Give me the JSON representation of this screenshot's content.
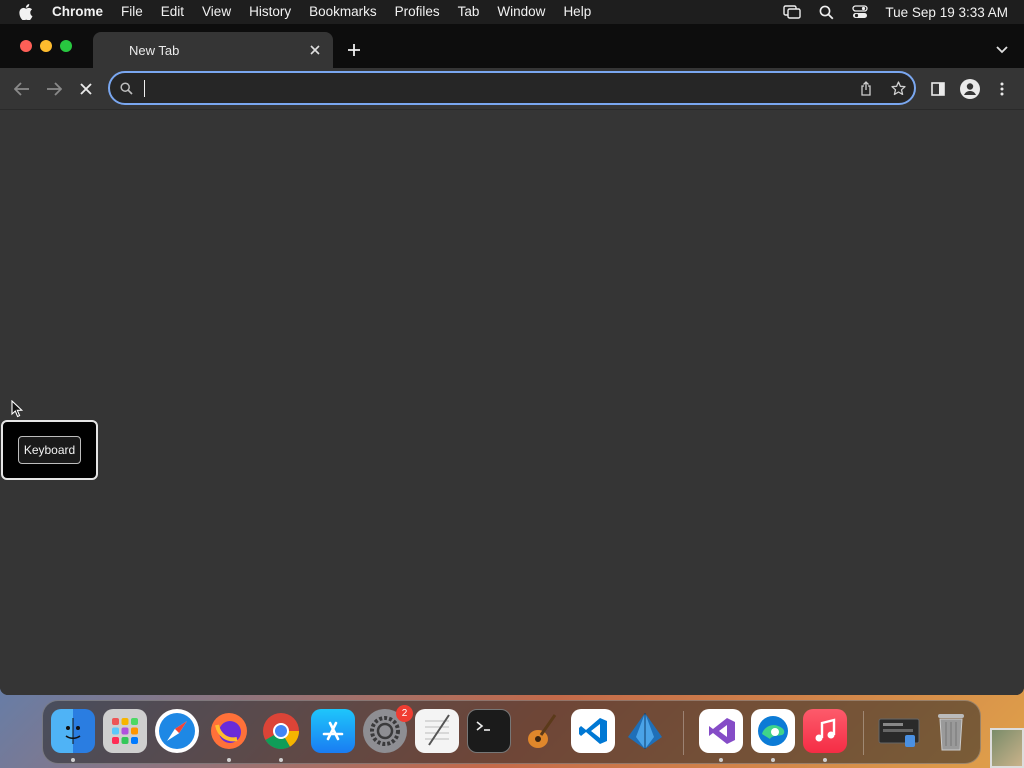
{
  "menubar": {
    "app_name": "Chrome",
    "items": [
      "File",
      "Edit",
      "View",
      "History",
      "Bookmarks",
      "Profiles",
      "Tab",
      "Window",
      "Help"
    ],
    "clock": "Tue Sep 19  3:33 AM"
  },
  "tabs": [
    {
      "title": "New Tab",
      "active": true
    }
  ],
  "omnibox": {
    "value": "",
    "focused": true
  },
  "keyboard_popover": {
    "button_label": "Keyboard"
  },
  "dock": {
    "apps": [
      {
        "name": "Finder",
        "icon": "finder-icon",
        "running": true
      },
      {
        "name": "Launchpad",
        "icon": "launchpad-icon",
        "running": false
      },
      {
        "name": "Safari",
        "icon": "safari-icon",
        "running": false
      },
      {
        "name": "Firefox",
        "icon": "firefox-icon",
        "running": true
      },
      {
        "name": "Chrome",
        "icon": "chrome-icon",
        "running": true
      },
      {
        "name": "App Store",
        "icon": "appstore-icon",
        "running": false
      },
      {
        "name": "System Settings",
        "icon": "settings-icon",
        "running": false,
        "badge": "2"
      },
      {
        "name": "TextEdit",
        "icon": "textedit-icon",
        "running": false
      },
      {
        "name": "Terminal",
        "icon": "terminal-icon",
        "running": false
      },
      {
        "name": "GarageBand",
        "icon": "garageband-icon",
        "running": false
      },
      {
        "name": "Visual Studio Code",
        "icon": "vscode-icon",
        "running": false
      },
      {
        "name": "Mountain App",
        "icon": "mountain-icon",
        "running": false
      },
      {
        "name": "Visual Studio",
        "icon": "visualstudio-icon",
        "running": true
      },
      {
        "name": "Edge",
        "icon": "edge-icon",
        "running": true
      },
      {
        "name": "Music",
        "icon": "music-icon",
        "running": true
      },
      {
        "name": "Downloads",
        "icon": "downloads-icon",
        "running": false
      },
      {
        "name": "Trash",
        "icon": "trash-icon",
        "running": false
      }
    ]
  },
  "colors": {
    "omnibox_focus": "#7aa7f0",
    "window_bg": "#353535",
    "tabstrip_bg": "#0d0d0d"
  }
}
